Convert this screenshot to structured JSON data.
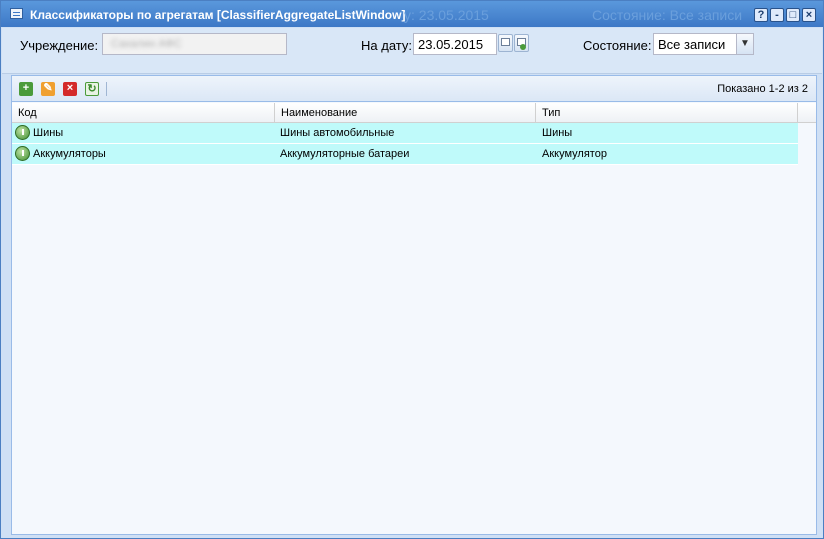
{
  "window": {
    "title": "Классификаторы по агрегатам [ClassifierAggregateListWindow]",
    "ghost_date": "у: 23.05.2015",
    "ghost_state": "Состояние: Все записи",
    "tools": {
      "help": "?",
      "minimize": "-",
      "maximize": "□",
      "close": "×"
    }
  },
  "filters": {
    "institution_label": "Учреждение:",
    "institution_value": "Сахалин АФС",
    "date_label": "На дату:",
    "date_value": "23.05.2015",
    "state_label": "Состояние:",
    "state_value": "Все записи"
  },
  "toolbar": {
    "paging": "Показано 1-2 из 2"
  },
  "grid": {
    "columns": [
      "Код",
      "Наименование",
      "Тип"
    ],
    "rows": [
      {
        "code": "Шины",
        "name": "Шины автомобильные",
        "type": "Шины"
      },
      {
        "code": "Аккумуляторы",
        "name": "Аккумуляторные батареи",
        "type": "Аккумулятор"
      }
    ]
  },
  "colors": {
    "titlebar": "#3d78c6",
    "row_highlight": "#bffafa",
    "add": "#4b9b3a",
    "edit": "#f0a030",
    "delete": "#d42a2a"
  }
}
